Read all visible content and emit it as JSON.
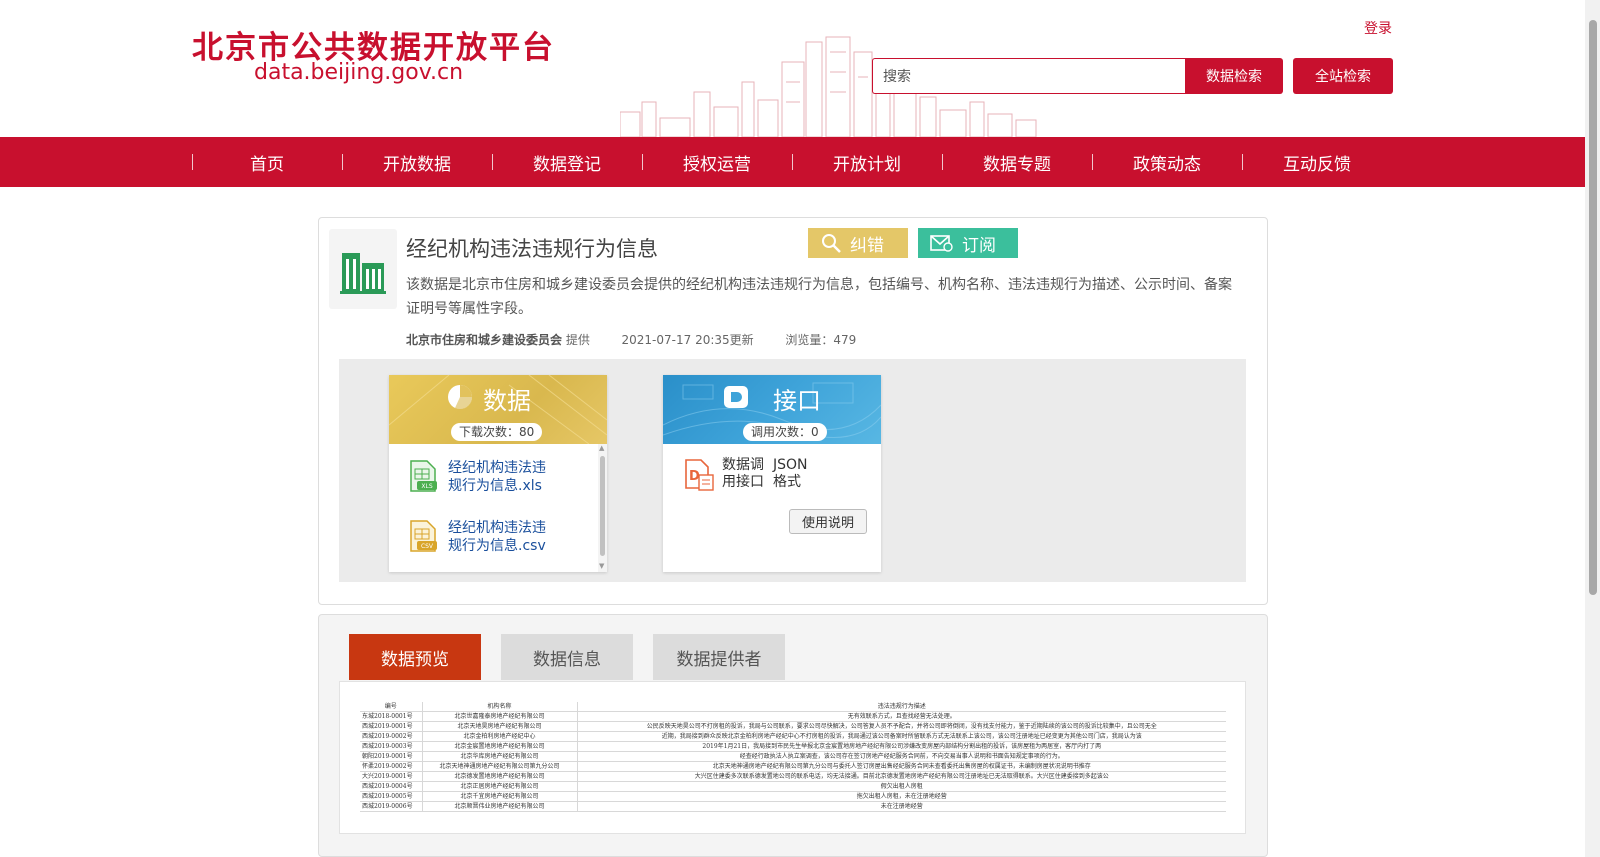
{
  "header": {
    "logo_cn": "北京市公共数据开放平台",
    "logo_en": "data.beijing.gov.cn",
    "login": "登录",
    "search_placeholder": "搜索",
    "data_search_button": "数据检索",
    "site_search_button": "全站检索"
  },
  "nav": {
    "items": [
      "首页",
      "开放数据",
      "数据登记",
      "授权运营",
      "开放计划",
      "数据专题",
      "政策动态",
      "互动反馈"
    ]
  },
  "dataset": {
    "title": "经纪机构违法违规行为信息",
    "correct_button": "纠错",
    "subscribe_button": "订阅",
    "description": "该数据是北京市住房和城乡建设委员会提供的经纪机构违法违规行为信息，包括编号、机构名称、违法违规行为描述、公示时间、备案证明号等属性字段。",
    "provider": "北京市住房和城乡建设委员会",
    "provider_suffix": "提供",
    "updated": "2021-07-17 20:35更新",
    "views": "浏览量：479"
  },
  "data_panel": {
    "label": "数据",
    "downloads": "下载次数：80",
    "files": [
      {
        "name_line1": "经纪机构违法违",
        "name_line2": "规行为信息.xls",
        "icon": "xls-file-icon",
        "icon_text": "XLS"
      },
      {
        "name_line1": "经纪机构违法违",
        "name_line2": "规行为信息.csv",
        "icon": "csv-file-icon",
        "icon_text": "CSV"
      }
    ]
  },
  "api_panel": {
    "label": "接口",
    "calls": "调用次数：0",
    "type_line1": "数据调",
    "type_line2": "用接口",
    "format_line1": "JSON",
    "format_line2": "格式",
    "usage_button": "使用说明"
  },
  "tabs": [
    "数据预览",
    "数据信息",
    "数据提供者"
  ],
  "preview": {
    "headers": [
      "编号",
      "机构名称",
      "违法违规行为描述"
    ],
    "rows": [
      [
        "东城2018-0001号",
        "北京世嘉隆泰房地产经纪有限公司",
        "无有效联系方式，且查找经营无法处理。"
      ],
      [
        "西城2019-0001号",
        "北京天地昊房地产经纪有限公司",
        "公民反映天地昊公司不打房租的投诉，我局与公司联系，要求公司尽快解决，公司答复人员不予配合，并将公司即将倒闭，没有找支付能力，鉴于近期陆续的该公司的投诉比较集中，且公司无全"
      ],
      [
        "西城2019-0002号",
        "北京金柏利房地产经纪中心",
        "近期，我局接到群众反映北京金柏利房地产经纪中心不打房租的投诉，我局通过该公司备案时所留联系方式无法联系上该公司，该公司注册地址已经变更为其他公司门店，我局认为该"
      ],
      [
        "西城2019-0003号",
        "北京金宸置地房地产经纪有限公司",
        "2019年1月21日，我局接到市民先生举报北京金宸置地房地产经纪有限公司涉嫌改变房屋内部结构分割出租的投诉，该房屋租为两居室，客厅内打了两"
      ],
      [
        "朝阳2019-0001号",
        "北京华库房地产经纪有限公司",
        "经查经行政执法人执立案调查，该公司存在签订房地产经纪服务合同前，不向交易当事人说明和书面告知规定事项的行为。"
      ],
      [
        "怀柔2019-0002号",
        "北京天地神通房地产经纪有限公司第九分公司",
        "北京天地神通房地产经纪有限公司第九分公司与委托人签订房屋出售经纪服务合同未查看委托出售房屋的权属证书，未编制房屋状况说明书推存"
      ],
      [
        "大兴2019-0001号",
        "北京德发置地房地产经纪有限公司",
        "大兴区住建委多次联系德发置地公司的联系电话，均无法接通。目前北京德发置地房地产经纪有限公司注册地址已无法取得联系。大兴区住建委接到多起该公"
      ],
      [
        "西城2019-0004号",
        "北京正居房地产经纪有限公司",
        "假欠出租人房租"
      ],
      [
        "西城2019-0005号",
        "北京千宜房地产经纪有限公司",
        "拖欠出租人房租，未在注册地经营"
      ],
      [
        "西城2019-0006号",
        "北京顺晋伟业房地产经纪有限公司",
        "未在注册地经营"
      ]
    ]
  },
  "colors": {
    "brand_red": "#c8102e",
    "active_tab": "#c83711",
    "correct_yellow": "#e4c768",
    "subscribe_green": "#3bbf9c"
  }
}
